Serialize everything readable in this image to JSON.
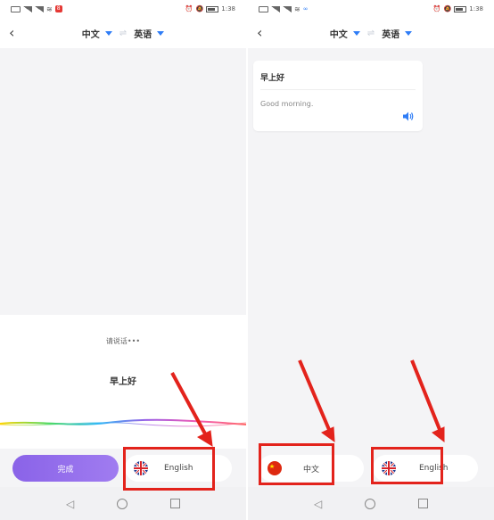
{
  "status": {
    "left_time": "1:38",
    "right_time": "1:38",
    "notification_badge": "8"
  },
  "nav": {
    "source_lang": "中文",
    "target_lang": "英语",
    "swap_glyph": "⇌"
  },
  "left": {
    "prompt": "请说话•••",
    "recognized_text": "早上好",
    "done_label": "完成",
    "lang_option_label": "English"
  },
  "right": {
    "source_text": "早上好",
    "translated_text": "Good morning.",
    "chinese_button_label": "中文",
    "english_button_label": "English"
  },
  "colors": {
    "accent_blue": "#2f7df6",
    "done_purple": "#8a63e8",
    "annotation_red": "#e3231c"
  },
  "icons": {
    "back": "chevron-left-icon",
    "speaker": "speaker-icon",
    "uk_flag": "uk-flag-icon",
    "cn_flag": "china-flag-icon"
  }
}
